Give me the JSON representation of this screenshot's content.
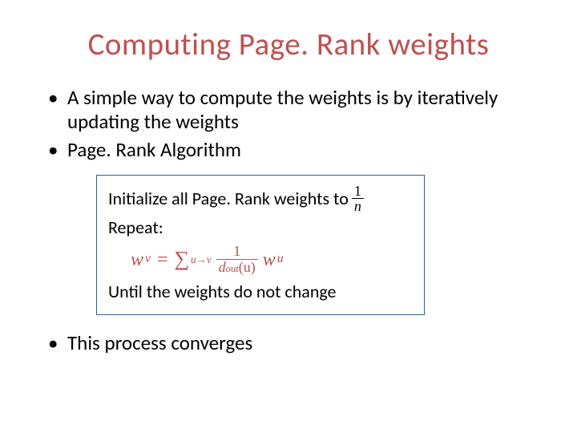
{
  "title": "Computing Page. Rank weights",
  "bullets": {
    "b1": "A simple way to compute the weights is by iteratively updating the weights",
    "b2": "Page. Rank Algorithm",
    "b3": "This process converges"
  },
  "algo": {
    "init_prefix": "Initialize all Page. Rank weights to ",
    "init_frac_num": "1",
    "init_frac_den": "n",
    "repeat": "Repeat:",
    "formula": {
      "lhs_var": "w",
      "lhs_sub": "v",
      "eq": "=",
      "sigma": "∑",
      "sigma_sub": "u→v",
      "frac_num": "1",
      "frac_den_d": "d",
      "frac_den_sub": "out",
      "frac_den_arg": "(u)",
      "rhs_var": "w",
      "rhs_sub": "u"
    },
    "until": "Until the weights do not change"
  }
}
